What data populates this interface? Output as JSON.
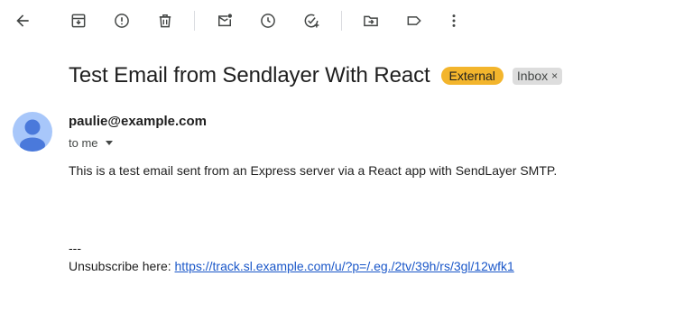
{
  "toolbar": {
    "buttons": [
      {
        "name": "back-arrow-icon"
      },
      {
        "name": "archive-icon"
      },
      {
        "name": "report-spam-icon"
      },
      {
        "name": "delete-icon"
      },
      {
        "name": "mark-unread-icon"
      },
      {
        "name": "snooze-icon"
      },
      {
        "name": "add-to-tasks-icon"
      },
      {
        "name": "move-to-icon"
      },
      {
        "name": "label-icon"
      },
      {
        "name": "more-options-icon"
      }
    ]
  },
  "message": {
    "subject": "Test Email from Sendlayer With React",
    "labels": {
      "external": "External",
      "inbox": "Inbox"
    },
    "inbox_close": "×",
    "sender": "paulie@example.com",
    "recipient": "to me",
    "body": "This is a test email sent from an Express server via a React app with SendLayer SMTP.",
    "signature_separator": "---",
    "unsubscribe_prefix": "Unsubscribe here: ",
    "unsubscribe_link": "https://track.sl.example.com/u/?p=/.eg./2tv/39h/rs/3gl/12wfk1"
  },
  "colors": {
    "external_badge": "#f3b52c",
    "inbox_badge": "#dddddd",
    "avatar_bg": "#a8c7fa",
    "avatar_fg": "#4a79db",
    "link": "#1a57c9",
    "icon": "#444746"
  }
}
